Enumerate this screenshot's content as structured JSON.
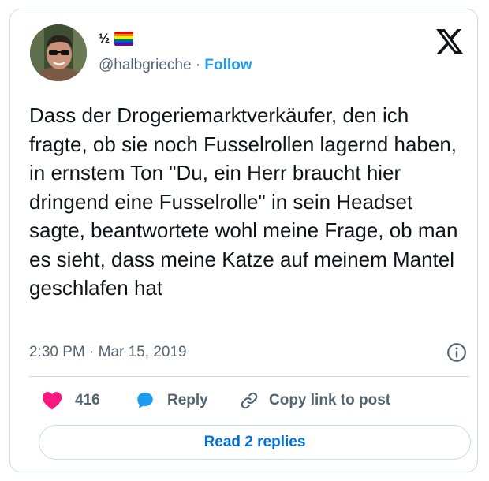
{
  "author": {
    "display_name": "½",
    "handle": "@halbgrieche",
    "separator": "·",
    "follow_label": "Follow",
    "flag_colors": [
      "#e40303",
      "#ff8c00",
      "#ffed00",
      "#008026",
      "#004dff",
      "#750787"
    ]
  },
  "tweet": {
    "text": "Dass der Drogeriemarktverkäufer, den ich fragte, ob sie noch Fusselrollen lagernd haben, in ernstem Ton \"Du, ein Herr braucht hier dringend eine Fusselrolle\" in sein Headset sagte, beantwortete wohl meine Frage, ob man es sieht, dass meine Katze auf meinem Mantel geschlafen hat",
    "time": "2:30 PM",
    "separator": "·",
    "date": "Mar 15, 2019"
  },
  "actions": {
    "like_count": "416",
    "reply_label": "Reply",
    "copy_link_label": "Copy link to post"
  },
  "footer": {
    "read_replies_label": "Read 2 replies"
  },
  "icons": {
    "logo": "x-logo-icon",
    "info": "info-icon",
    "like": "heart-icon",
    "reply": "reply-bubble-icon",
    "copy": "link-icon"
  },
  "colors": {
    "like": "#f91880",
    "reply": "#1d9bf0",
    "link": "#1d9bf0",
    "read_replies": "#006fd6",
    "secondary_text": "#536471"
  }
}
